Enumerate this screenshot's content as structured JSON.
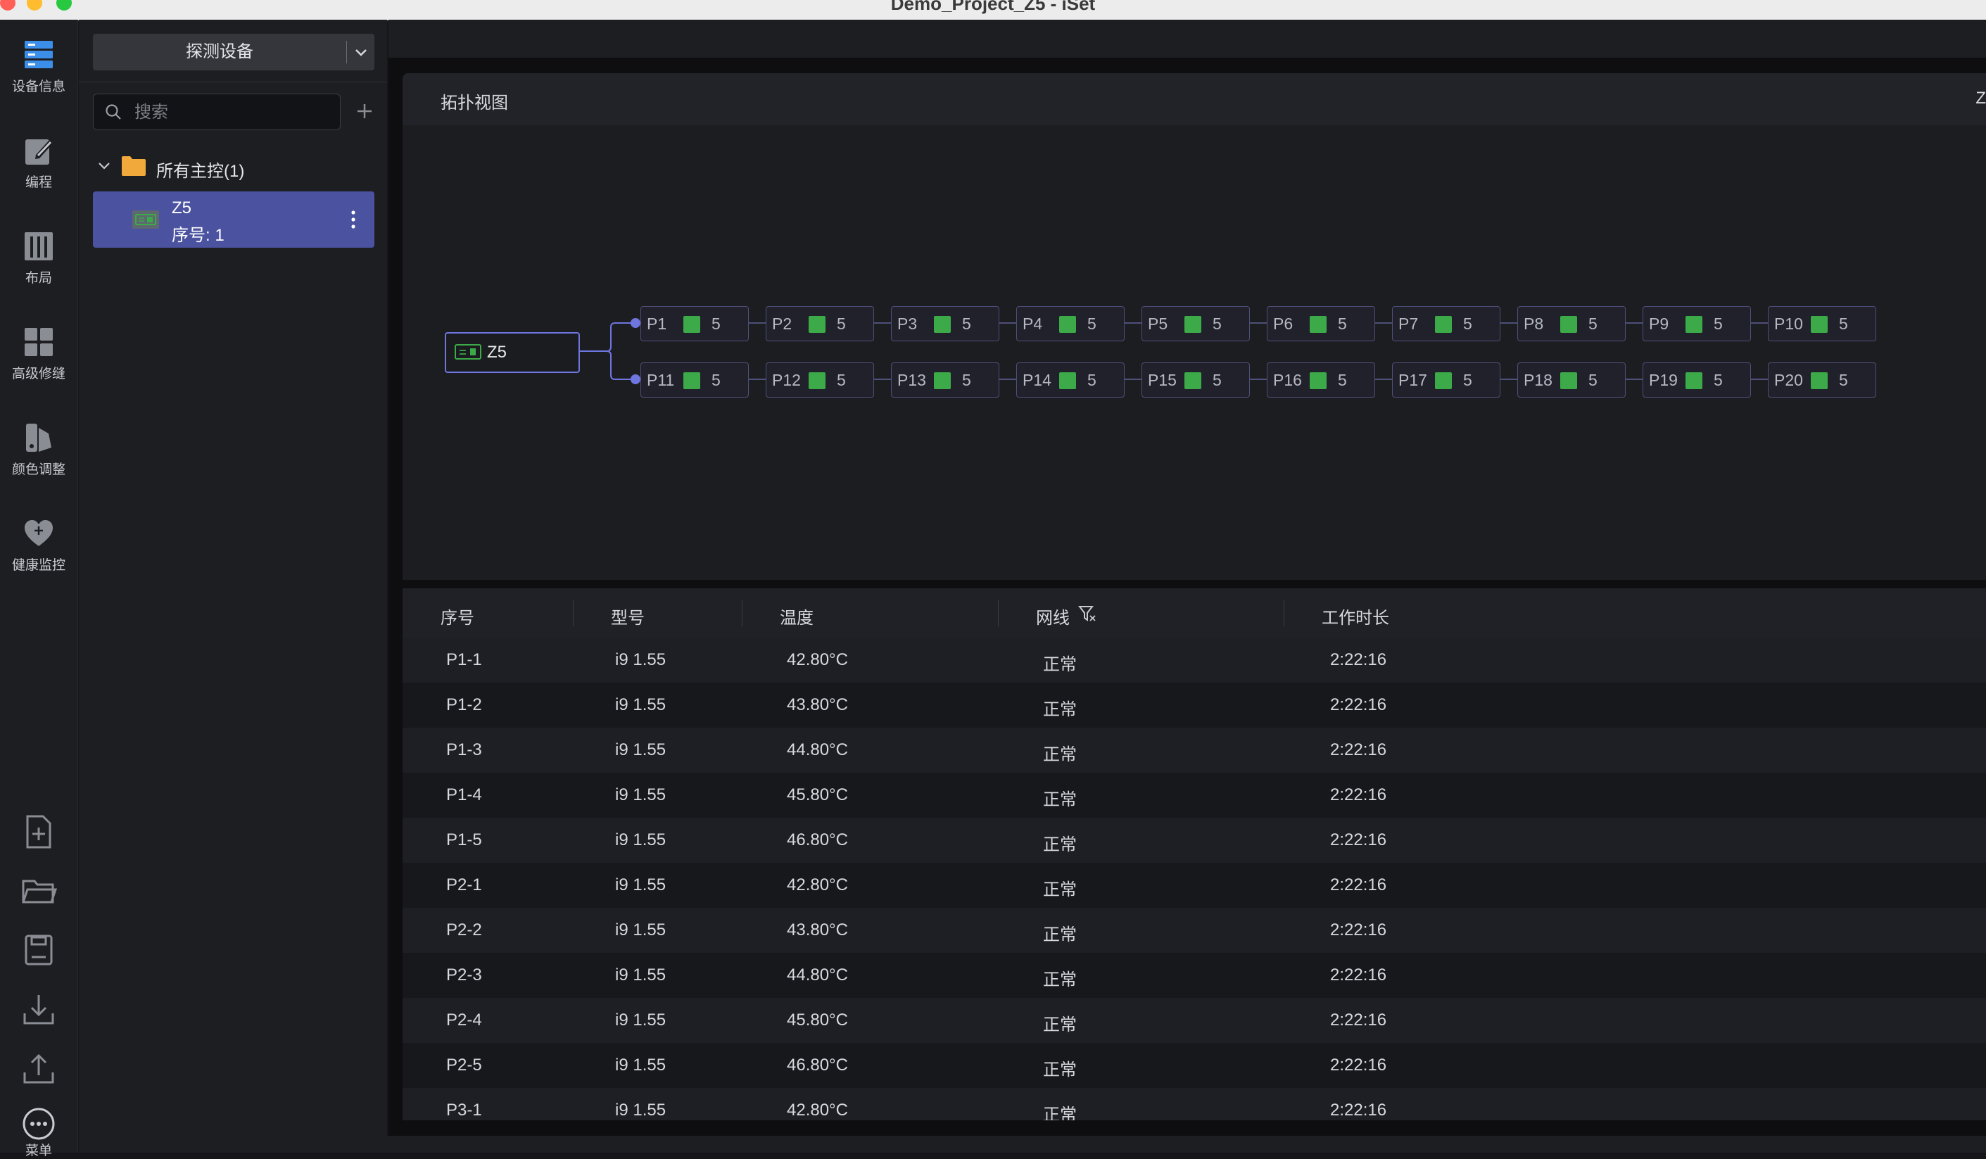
{
  "window": {
    "title": "Demo_Project_Z5 - iSet",
    "colors": {
      "close": "#ff5f57",
      "minimize": "#febc2e",
      "zoom": "#28c840"
    }
  },
  "rail": {
    "items": [
      {
        "label": "设备信息",
        "icon": "device-info-icon"
      },
      {
        "label": "编程",
        "icon": "edit-icon"
      },
      {
        "label": "布局",
        "icon": "layout-icon"
      },
      {
        "label": "高级修缝",
        "icon": "grid-icon"
      },
      {
        "label": "颜色调整",
        "icon": "color-adjust-icon"
      },
      {
        "label": "健康监控",
        "icon": "health-heart-icon"
      }
    ],
    "bottom_icons": [
      "new-file-icon",
      "open-folder-icon",
      "save-icon",
      "import-icon",
      "export-icon"
    ],
    "menu": {
      "label": "菜单",
      "icon": "more-icon"
    }
  },
  "device_panel": {
    "detect_button": "探测设备",
    "search_placeholder": "搜索",
    "group_label": "所有主控(1)",
    "device": {
      "name": "Z5",
      "seq": "序号: 1"
    }
  },
  "topology": {
    "title": "拓扑视图",
    "right_label": "Z",
    "controller": "Z5",
    "status_color": "#3daa4a",
    "ports": [
      {
        "label": "P1",
        "count": "5"
      },
      {
        "label": "P2",
        "count": "5"
      },
      {
        "label": "P3",
        "count": "5"
      },
      {
        "label": "P4",
        "count": "5"
      },
      {
        "label": "P5",
        "count": "5"
      },
      {
        "label": "P6",
        "count": "5"
      },
      {
        "label": "P7",
        "count": "5"
      },
      {
        "label": "P8",
        "count": "5"
      },
      {
        "label": "P9",
        "count": "5"
      },
      {
        "label": "P10",
        "count": "5"
      },
      {
        "label": "P11",
        "count": "5"
      },
      {
        "label": "P12",
        "count": "5"
      },
      {
        "label": "P13",
        "count": "5"
      },
      {
        "label": "P14",
        "count": "5"
      },
      {
        "label": "P15",
        "count": "5"
      },
      {
        "label": "P16",
        "count": "5"
      },
      {
        "label": "P17",
        "count": "5"
      },
      {
        "label": "P18",
        "count": "5"
      },
      {
        "label": "P19",
        "count": "5"
      },
      {
        "label": "P20",
        "count": "5"
      }
    ]
  },
  "table": {
    "columns": [
      "序号",
      "型号",
      "温度",
      "网线",
      "工作时长"
    ],
    "rows": [
      [
        "P1-1",
        "i9 1.55",
        "42.80°C",
        "正常",
        "2:22:16"
      ],
      [
        "P1-2",
        "i9 1.55",
        "43.80°C",
        "正常",
        "2:22:16"
      ],
      [
        "P1-3",
        "i9 1.55",
        "44.80°C",
        "正常",
        "2:22:16"
      ],
      [
        "P1-4",
        "i9 1.55",
        "45.80°C",
        "正常",
        "2:22:16"
      ],
      [
        "P1-5",
        "i9 1.55",
        "46.80°C",
        "正常",
        "2:22:16"
      ],
      [
        "P2-1",
        "i9 1.55",
        "42.80°C",
        "正常",
        "2:22:16"
      ],
      [
        "P2-2",
        "i9 1.55",
        "43.80°C",
        "正常",
        "2:22:16"
      ],
      [
        "P2-3",
        "i9 1.55",
        "44.80°C",
        "正常",
        "2:22:16"
      ],
      [
        "P2-4",
        "i9 1.55",
        "45.80°C",
        "正常",
        "2:22:16"
      ],
      [
        "P2-5",
        "i9 1.55",
        "46.80°C",
        "正常",
        "2:22:16"
      ],
      [
        "P3-1",
        "i9 1.55",
        "42.80°C",
        "正常",
        "2:22:16"
      ]
    ]
  }
}
